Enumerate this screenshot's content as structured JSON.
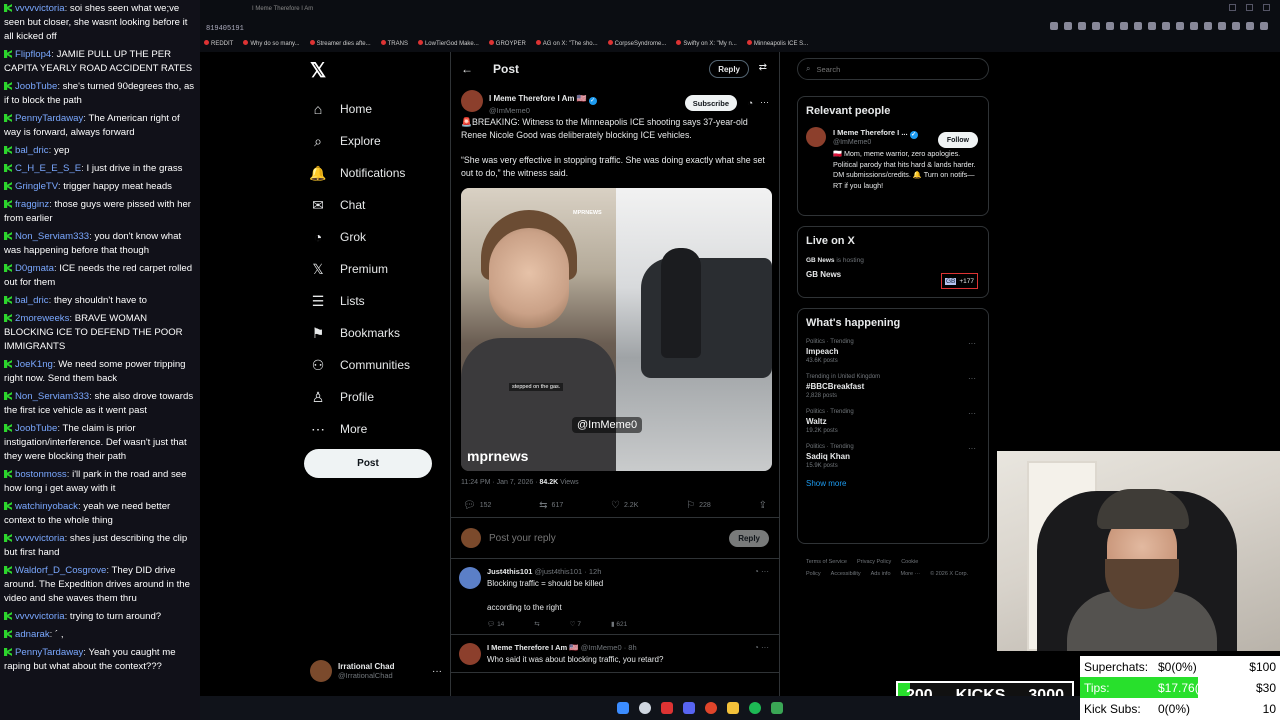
{
  "chat": [
    {
      "user": "vvvvvictoria",
      "text": "soi shes seen what we;ve seen but closer, she wasnt looking before it all kicked off"
    },
    {
      "user": "Flipflop4",
      "text": "JAMIE PULL UP THE PER CAPITA YEARLY ROAD ACCIDENT RATES"
    },
    {
      "user": "JoobTube",
      "text": "she's turned 90degrees tho, as if to block the path"
    },
    {
      "user": "PennyTardaway",
      "text": "The American right of way is forward, always forward"
    },
    {
      "user": "bal_dric",
      "text": "yep"
    },
    {
      "user": "C_H_E_E_S_E",
      "text": "I just drive in the grass"
    },
    {
      "user": "GringleTV",
      "text": "trigger happy meat heads"
    },
    {
      "user": "fragginz",
      "text": "those guys were pissed with her from earlier"
    },
    {
      "user": "Non_Serviam333",
      "text": "you don't know what was happening before that though"
    },
    {
      "user": "D0gmata",
      "text": "ICE needs the red carpet rolled out for them"
    },
    {
      "user": "bal_dric",
      "text": "they shouldn't have to"
    },
    {
      "user": "2moreweeks",
      "text": "BRAVE WOMAN BLOCKING ICE TO DEFEND THE POOR IMMIGRANTS"
    },
    {
      "user": "JoeK1ng",
      "text": "We need some power tripping right now. Send them back"
    },
    {
      "user": "Non_Serviam333",
      "text": "she also drove towards the first ice vehicle as it went past"
    },
    {
      "user": "JoobTube",
      "text": "The claim is prior instigation/interference. Def wasn't just that they were blocking their path"
    },
    {
      "user": "bostonmoss",
      "text": "i'll park in the road and see how long i get away with it"
    },
    {
      "user": "watchinyoback",
      "text": "yeah we need better context to the whole thing"
    },
    {
      "user": "vvvvvictoria",
      "text": "shes just describing the clip but first hand"
    },
    {
      "user": "Waldorf_D_Cosgrove",
      "text": "They DID drive around. The Expedition drives around in the video and she waves them thru"
    },
    {
      "user": "vvvvvictoria",
      "text": "trying to turn around?"
    },
    {
      "user": "adnarak",
      "text": "´ ,"
    },
    {
      "user": "PennyTardaway",
      "text": "Yeah you caught me raping but what about the context???"
    }
  ],
  "browser": {
    "url_fragment": "819405191",
    "tab_label": "I Meme Therefore I Am",
    "bookmarks": [
      "REDDIT",
      "Why do so many...",
      "Streamer dies afte...",
      "TRANS",
      "LowTierGod Make...",
      "GROYPER",
      "AG on X: \"The sho...",
      "CorpseSyndrome...",
      "Swifty on X: \"My n...",
      "Minneapolis ICE S..."
    ]
  },
  "nav": {
    "items": [
      {
        "label": "Home",
        "icon": "home-icon",
        "glyph": "⌂"
      },
      {
        "label": "Explore",
        "icon": "search-icon",
        "glyph": "⌕"
      },
      {
        "label": "Notifications",
        "icon": "bell-icon",
        "glyph": "🔔"
      },
      {
        "label": "Chat",
        "icon": "mail-icon",
        "glyph": "✉"
      },
      {
        "label": "Grok",
        "icon": "grok-icon",
        "glyph": "◔"
      },
      {
        "label": "Premium",
        "icon": "x-premium-icon",
        "glyph": "𝕏"
      },
      {
        "label": "Lists",
        "icon": "list-icon",
        "glyph": "☰"
      },
      {
        "label": "Bookmarks",
        "icon": "bookmark-icon",
        "glyph": "⚑"
      },
      {
        "label": "Communities",
        "icon": "communities-icon",
        "glyph": "⚇"
      },
      {
        "label": "Profile",
        "icon": "profile-icon",
        "glyph": "♙"
      },
      {
        "label": "More",
        "icon": "more-icon",
        "glyph": "⋯"
      }
    ],
    "post_label": "Post",
    "account": {
      "name": "Irrational Chad",
      "handle": "@IrrationalChad"
    }
  },
  "main": {
    "title": "Post",
    "reply_label": "Reply",
    "tweet": {
      "name": "I Meme Therefore I Am 🇺🇸",
      "handle": "@ImMeme0",
      "subscribe_label": "Subscribe",
      "text1": "🚨BREAKING: Witness to the Minneapolis ICE shooting says 37-year-old Renee Nicole Good was deliberately blocking ICE vehicles.",
      "text2": "“She was very effective in stopping traffic. She was doing exactly what she set out to do,” the witness said.",
      "media": {
        "watermark": "@ImMeme0",
        "source": "mprnews",
        "subtitle": "stepped on the gas.",
        "top_label": "MPRNEWS"
      },
      "time": "11:24 PM · Jan 7, 2026 · ",
      "views": "84.2K",
      "views_label": " Views",
      "stats": {
        "replies": "152",
        "reposts": "617",
        "likes": "2.2K",
        "bookmarks": "228"
      }
    },
    "reply_placeholder": "Post your reply",
    "reply_button": "Reply",
    "replies": [
      {
        "name": "Just4this101",
        "handle": "@just4this101 · 12h",
        "lines": [
          "Blocking traffic = should be killed",
          "",
          "according to the right"
        ],
        "stats": [
          "14",
          "",
          "7",
          "621"
        ]
      },
      {
        "name": "I Meme Therefore I Am 🇺🇸",
        "handle": "@ImMeme0 · 8h",
        "lines": [
          "Who said it was about blocking traffic, you retard?"
        ],
        "stats": []
      }
    ]
  },
  "right": {
    "search_placeholder": "Search",
    "relevant_title": "Relevant people",
    "relevant": {
      "name": "I Meme Therefore I ...",
      "handle": "@ImMeme0",
      "follow": "Follow",
      "bio": "🇵🇱 Mom, meme warrior, zero apologies. Political parody that hits hard & lands harder. DM submissions/credits. 🔔 Turn on notifs—RT if you laugh!"
    },
    "live_title": "Live on X",
    "live": {
      "host": "GB News",
      "hosting": " is hosting",
      "name": "GB News",
      "badge": "GB",
      "count": "+177"
    },
    "happening_title": "What's happening",
    "trends": [
      {
        "category": "Politics · Trending",
        "name": "Impeach",
        "count": "43.6K posts"
      },
      {
        "category": "Trending in United Kingdom",
        "name": "#BBCBreakfast",
        "count": "2,828 posts"
      },
      {
        "category": "Politics · Trending",
        "name": "Waltz",
        "count": "19.2K posts"
      },
      {
        "category": "Politics · Trending",
        "name": "Sadiq Khan",
        "count": "15.9K posts"
      }
    ],
    "show_more": "Show more",
    "footer": [
      "Terms of Service",
      "Privacy Policy",
      "Cookie Policy",
      "Accessibility",
      "Ads info",
      "More ···",
      "© 2026 X Corp."
    ]
  },
  "stream": {
    "kicks_current": "200",
    "kicks_label": "KICKS",
    "kicks_goal": "3000",
    "kicks_progress": 0.07,
    "superchats": {
      "label": "Superchats:",
      "value": "$0(0%)",
      "goal": "$100"
    },
    "tips": {
      "label": "Tips:",
      "value": "$17.76(59%)",
      "goal": "$30",
      "progress": 0.59
    },
    "kick_subs": {
      "label": "Kick Subs:",
      "value": "0(0%)",
      "goal": "10"
    }
  },
  "colors": {
    "accent": "#1d9bf0",
    "chat_name": "#7aa8ff",
    "goal_green": "#28e02c",
    "background": "#000000"
  }
}
